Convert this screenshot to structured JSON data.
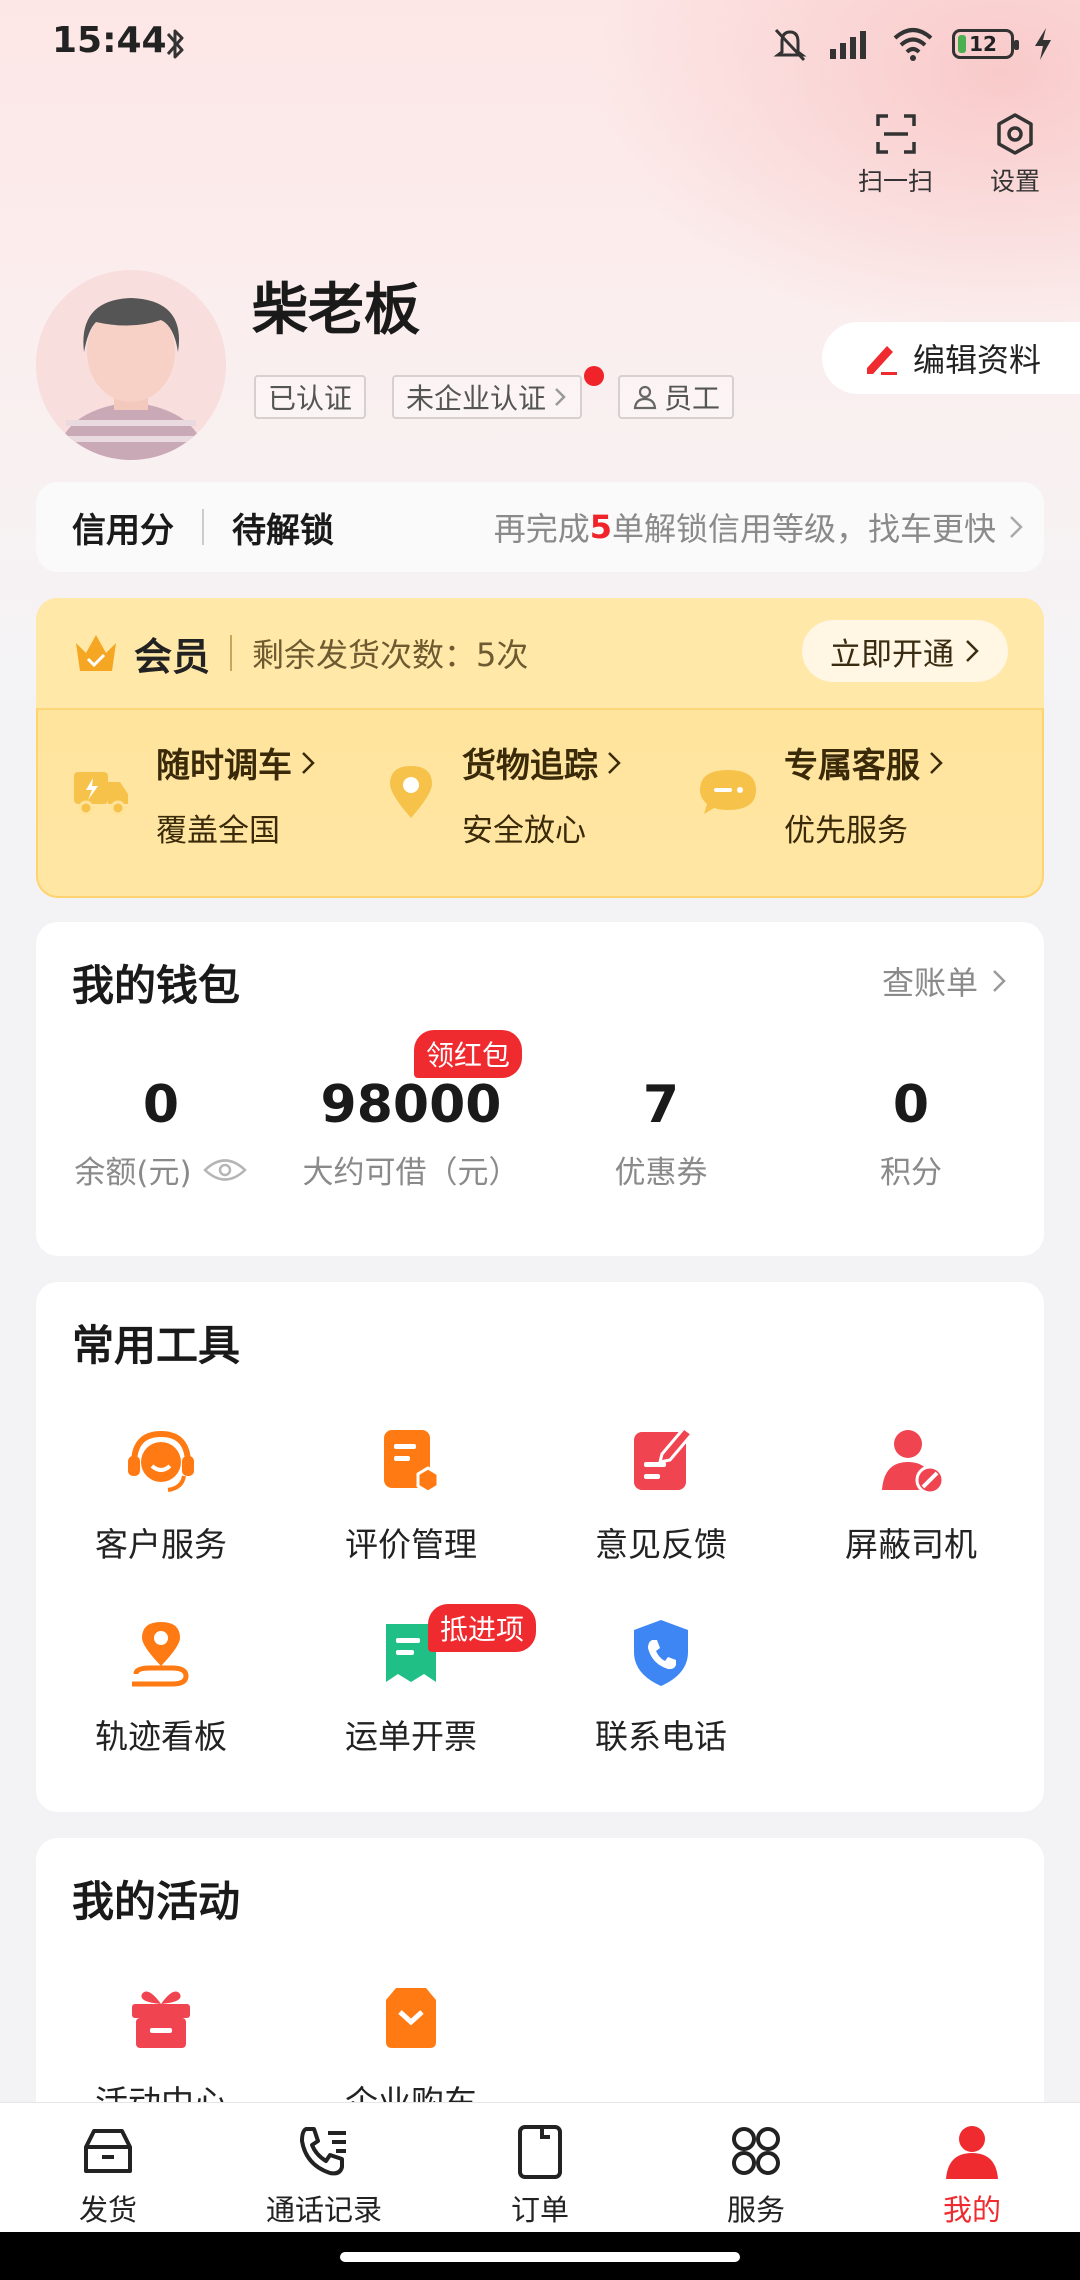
{
  "status": {
    "time": "15:44",
    "battery": "12"
  },
  "top_actions": {
    "scan": "扫一扫",
    "settings": "设置"
  },
  "profile": {
    "name": "柴老板",
    "tags": [
      "已认证",
      "未企业认证",
      "员工"
    ],
    "edit_label": "编辑资料"
  },
  "credit": {
    "label": "信用分",
    "status": "待解锁",
    "hint_pre": "再完成",
    "hint_num": "5",
    "hint_post": "单解锁信用等级，找车更快"
  },
  "member": {
    "title": "会员",
    "remaining": "剩余发货次数：5次",
    "open_label": "立即开通",
    "perks": [
      {
        "title": "随时调车",
        "sub": "覆盖全国",
        "icon": "truck-icon"
      },
      {
        "title": "货物追踪",
        "sub": "安全放心",
        "icon": "location-pin-icon"
      },
      {
        "title": "专属客服",
        "sub": "优先服务",
        "icon": "chat-icon"
      }
    ]
  },
  "wallet": {
    "title": "我的钱包",
    "bill_label": "查账单",
    "items": [
      {
        "value": "0",
        "label": "余额(元)"
      },
      {
        "value": "98000",
        "label": "大约可借（元）",
        "badge": "领红包"
      },
      {
        "value": "7",
        "label": "优惠券"
      },
      {
        "value": "0",
        "label": "积分"
      }
    ]
  },
  "tools": {
    "title": "常用工具",
    "items": [
      {
        "label": "客户服务",
        "icon": "headset-icon"
      },
      {
        "label": "评价管理",
        "icon": "review-icon"
      },
      {
        "label": "意见反馈",
        "icon": "feedback-icon"
      },
      {
        "label": "屏蔽司机",
        "icon": "block-driver-icon"
      },
      {
        "label": "轨迹看板",
        "icon": "route-icon"
      },
      {
        "label": "运单开票",
        "icon": "invoice-icon",
        "badge": "抵进项"
      },
      {
        "label": "联系电话",
        "icon": "phone-shield-icon"
      }
    ]
  },
  "activities": {
    "title": "我的活动",
    "items": [
      {
        "label": "活动中心",
        "icon": "gift-icon"
      },
      {
        "label": "企业购车",
        "icon": "car-purchase-icon"
      }
    ]
  },
  "nav": [
    {
      "label": "发货",
      "icon": "ship-icon"
    },
    {
      "label": "通话记录",
      "icon": "call-log-icon"
    },
    {
      "label": "订单",
      "icon": "order-icon"
    },
    {
      "label": "服务",
      "icon": "service-icon"
    },
    {
      "label": "我的",
      "icon": "profile-icon",
      "active": true
    }
  ],
  "colors": {
    "accent": "#ef2b30",
    "orange": "#ff7a12",
    "member_gold": "#ffe39a",
    "blue": "#3f86f5",
    "green": "#1fbf86"
  }
}
